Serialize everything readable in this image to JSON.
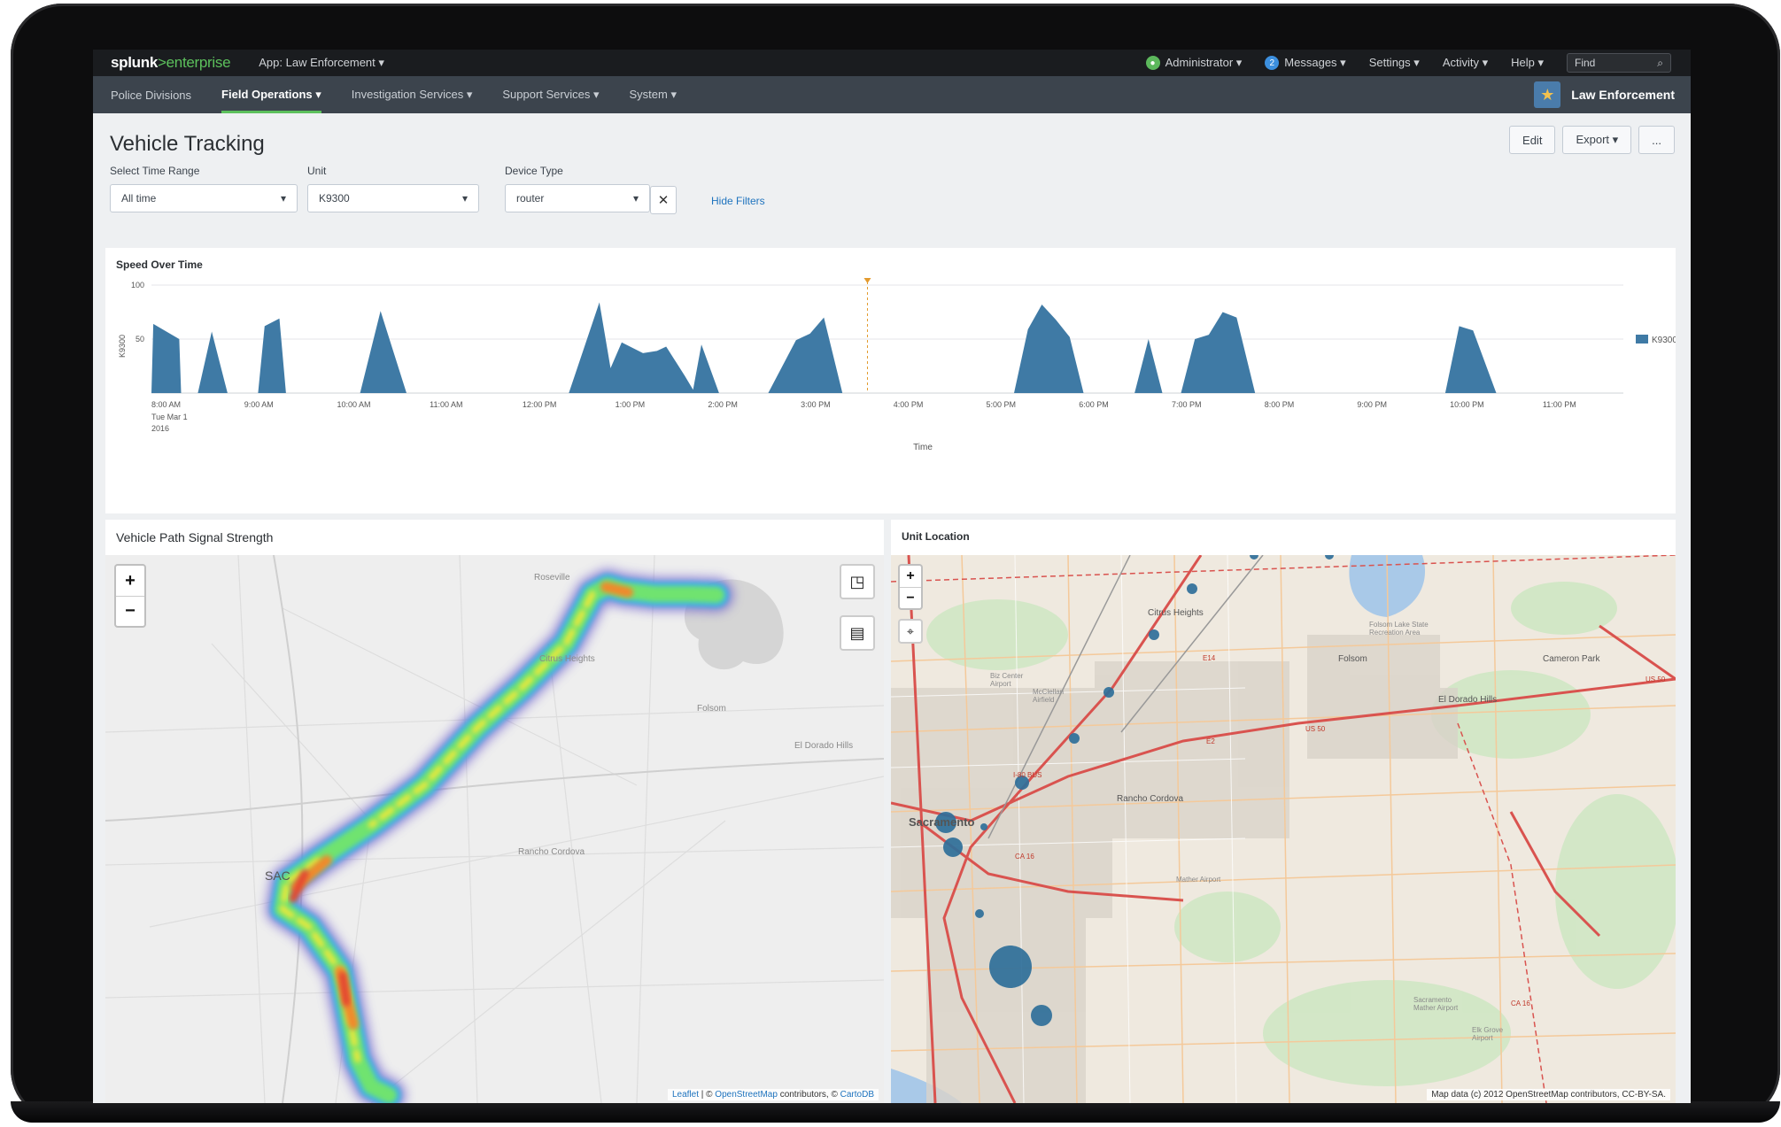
{
  "topbar": {
    "logo_main": "splunk",
    "logo_sep": ">",
    "logo_sub": "enterprise",
    "app_menu": "App: Law Enforcement ▾",
    "admin_label": "Administrator ▾",
    "messages_count": "2",
    "messages_label": "Messages ▾",
    "settings_label": "Settings ▾",
    "activity_label": "Activity ▾",
    "help_label": "Help ▾",
    "find_placeholder": "Find"
  },
  "navbar": {
    "items": [
      {
        "label": "Police Divisions"
      },
      {
        "label": "Field Operations ▾"
      },
      {
        "label": "Investigation Services ▾"
      },
      {
        "label": "Support Services ▾"
      },
      {
        "label": "System ▾"
      }
    ],
    "brand": "Law Enforcement"
  },
  "page": {
    "title": "Vehicle Tracking",
    "edit": "Edit",
    "export": "Export ▾",
    "more": "..."
  },
  "filters": {
    "time_label": "Select Time Range",
    "time_value": "All time",
    "unit_label": "Unit",
    "unit_value": "K9300",
    "device_label": "Device Type",
    "device_value": "router",
    "hide_filters": "Hide Filters"
  },
  "chart_panel": {
    "title": "Speed Over Time"
  },
  "chart_data": {
    "type": "area",
    "title": "Speed Over Time",
    "xlabel": "Time",
    "ylabel": "K9300",
    "ylim": [
      0,
      100
    ],
    "yticks": [
      "100",
      "50"
    ],
    "x_tick_labels": [
      "8:00 AM",
      "9:00 AM",
      "10:00 AM",
      "11:00 AM",
      "12:00 PM",
      "1:00 PM",
      "2:00 PM",
      "3:00 PM",
      "4:00 PM",
      "5:00 PM",
      "6:00 PM",
      "7:00 PM",
      "8:00 PM",
      "9:00 PM",
      "10:00 PM",
      "11:00 PM"
    ],
    "x_first_sub": [
      "Tue Mar 1",
      "2016"
    ],
    "legend": "right",
    "series": [
      {
        "name": "K9300",
        "color": "#3f7aa5",
        "points": [
          [
            0,
            0
          ],
          [
            0.02,
            64
          ],
          [
            0.3,
            50
          ],
          [
            0.32,
            0
          ],
          [
            0.5,
            0
          ],
          [
            0.65,
            57
          ],
          [
            0.82,
            0
          ],
          [
            1.15,
            0
          ],
          [
            1.22,
            62
          ],
          [
            1.38,
            69
          ],
          [
            1.45,
            0
          ],
          [
            2.25,
            0
          ],
          [
            2.47,
            76
          ],
          [
            2.75,
            0
          ],
          [
            4.5,
            0
          ],
          [
            4.83,
            84
          ],
          [
            4.95,
            23
          ],
          [
            5.07,
            47
          ],
          [
            5.3,
            37
          ],
          [
            5.45,
            39
          ],
          [
            5.55,
            43
          ],
          [
            5.75,
            16
          ],
          [
            5.84,
            3
          ],
          [
            5.93,
            45
          ],
          [
            6.12,
            0
          ],
          [
            6.65,
            0
          ],
          [
            6.95,
            49
          ],
          [
            7.1,
            55
          ],
          [
            7.25,
            70
          ],
          [
            7.45,
            0
          ],
          [
            7.7,
            0
          ],
          [
            8.25,
            0
          ],
          [
            9.3,
            0
          ],
          [
            9.45,
            59
          ],
          [
            9.6,
            82
          ],
          [
            9.75,
            68
          ],
          [
            9.9,
            52
          ],
          [
            10.05,
            0
          ],
          [
            10.6,
            0
          ],
          [
            10.75,
            50
          ],
          [
            10.9,
            0
          ],
          [
            11.1,
            0
          ],
          [
            11.25,
            50
          ],
          [
            11.4,
            54
          ],
          [
            11.55,
            75
          ],
          [
            11.7,
            70
          ],
          [
            11.9,
            0
          ],
          [
            13.95,
            0
          ],
          [
            14.1,
            62
          ],
          [
            14.25,
            58
          ],
          [
            14.5,
            0
          ]
        ]
      }
    ],
    "cursor_x": 7.72
  },
  "heatmap_panel": {
    "title": "Vehicle Path Signal Strength",
    "labels": {
      "roseville": "Roseville",
      "citrus": "Citrus Heights",
      "folsom": "Folsom",
      "eldorado": "El Dorado Hills",
      "rancho": "Rancho Cordova",
      "sac": "SAC"
    },
    "zoom_in": "+",
    "zoom_out": "−",
    "attribution_leaflet": "Leaflet",
    "attribution_osm": "OpenStreetMap",
    "attribution_contrib": "contributors, ©",
    "attribution_carto": "CartoDB",
    "attribution_pre": "| ©"
  },
  "location_panel": {
    "title": "Unit Location",
    "labels": {
      "citrus": "Citrus Heights",
      "folsom": "Folsom",
      "cameron": "Cameron Park",
      "eldorado": "El Dorado Hills",
      "rancho": "Rancho Cordova",
      "sacramento": "Sacramento",
      "mather": "Mather Airport",
      "mcclellan": "McClellan Airfield",
      "sacramento_airport": "Sacramento Mather Airport",
      "lake": "Folsom Lake State Recreation Area",
      "bizcenter": "Biz Center Airport",
      "elk": "Elk Grove Airport",
      "i80": "I-80 BUS",
      "us50a": "US 50",
      "us50b": "US 50",
      "ca16a": "CA 16",
      "ca16b": "CA 16",
      "e14": "E14",
      "e2": "E2"
    },
    "zoom_in": "+",
    "zoom_out": "−",
    "attribution": "Map data (c) 2012 OpenStreetMap contributors, CC-BY-SA."
  }
}
